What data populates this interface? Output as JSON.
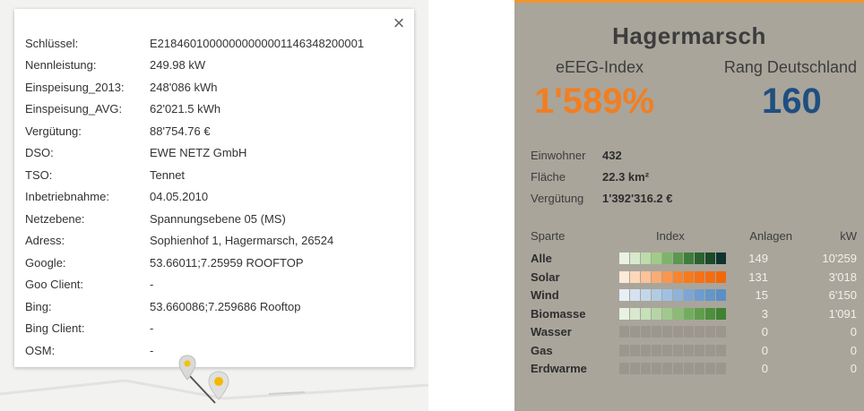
{
  "popup": {
    "close_glyph": "×",
    "rows": [
      {
        "key": "Schlüssel:",
        "value": "E21846010000000000001146348200001"
      },
      {
        "key": "Nennleistung:",
        "value": "249.98 kW"
      },
      {
        "key": "Einspeisung_2013:",
        "value": "248'086 kWh"
      },
      {
        "key": "Einspeisung_AVG:",
        "value": "62'021.5 kWh"
      },
      {
        "key": "Vergütung:",
        "value": "88'754.76 €"
      },
      {
        "key": "DSO:",
        "value": "EWE NETZ GmbH"
      },
      {
        "key": "TSO:",
        "value": "Tennet"
      },
      {
        "key": "Inbetriebnahme:",
        "value": "04.05.2010"
      },
      {
        "key": "Netzebene:",
        "value": "Spannungsebene 05 (MS)"
      },
      {
        "key": "Adress:",
        "value": "Sophienhof 1, Hagermarsch, 26524"
      },
      {
        "key": "Google:",
        "value": "53.66011;7.25959 ROOFTOP"
      },
      {
        "key": "Goo Client:",
        "value": "-"
      },
      {
        "key": "Bing:",
        "value": "53.660086;7.259686 Rooftop"
      },
      {
        "key": "Bing Client:",
        "value": "-"
      },
      {
        "key": "OSM:",
        "value": "-"
      }
    ]
  },
  "panel": {
    "title": "Hagermarsch",
    "index_label": "eEEG-Index",
    "index_value": "1'589%",
    "rank_label": "Rang Deutschland",
    "rank_value": "160",
    "colors": {
      "accent": "#f2962c",
      "index": "#f07f23",
      "rank": "#1f4f80",
      "background": "#a9a59b",
      "empty_swatch": "#9b978e"
    },
    "meta": [
      {
        "key": "Einwohner",
        "value": "432"
      },
      {
        "key": "Fläche",
        "value": "22.3 km²"
      },
      {
        "key": "Vergütung",
        "value": "1'392'316.2 €"
      }
    ],
    "headers": {
      "sparte": "Sparte",
      "index": "Index",
      "anlagen": "Anlagen",
      "kw": "kW"
    },
    "sparten": [
      {
        "name": "Alle",
        "anlagen": "149",
        "kw": "10'259",
        "colors": [
          "#e9f2e4",
          "#d6e9cc",
          "#bddcab",
          "#a0cc8a",
          "#7db46a",
          "#5b9950",
          "#3f7d3c",
          "#2a6330",
          "#1a4a2a",
          "#0e3330"
        ]
      },
      {
        "name": "Solar",
        "anlagen": "131",
        "kw": "3'018",
        "colors": [
          "#fde9d8",
          "#fcd7b9",
          "#fcc399",
          "#fbac74",
          "#fa9650",
          "#f8842f",
          "#f77a1d",
          "#f57118",
          "#f46d12",
          "#f0680c"
        ]
      },
      {
        "name": "Wind",
        "anlagen": "15",
        "kw": "6'150",
        "colors": [
          "#e8eef6",
          "#d5e2f1",
          "#c3d7eb",
          "#b1cbe5",
          "#a1c0e0",
          "#8fb2da",
          "#7ea6d3",
          "#6f9cce",
          "#6396ca",
          "#5b8fc6"
        ]
      },
      {
        "name": "Biomasse",
        "anlagen": "3",
        "kw": "1'091",
        "colors": [
          "#e8f1e3",
          "#d8e9cf",
          "#c7e0ba",
          "#b4d5a3",
          "#a0c98d",
          "#89bc75",
          "#72ad5e",
          "#5f9f4c",
          "#4d903b",
          "#3e8233"
        ]
      },
      {
        "name": "Wasser",
        "anlagen": "0",
        "kw": "0",
        "colors": []
      },
      {
        "name": "Gas",
        "anlagen": "0",
        "kw": "0",
        "colors": []
      },
      {
        "name": "Erdwarme",
        "anlagen": "0",
        "kw": "0",
        "colors": []
      }
    ]
  }
}
